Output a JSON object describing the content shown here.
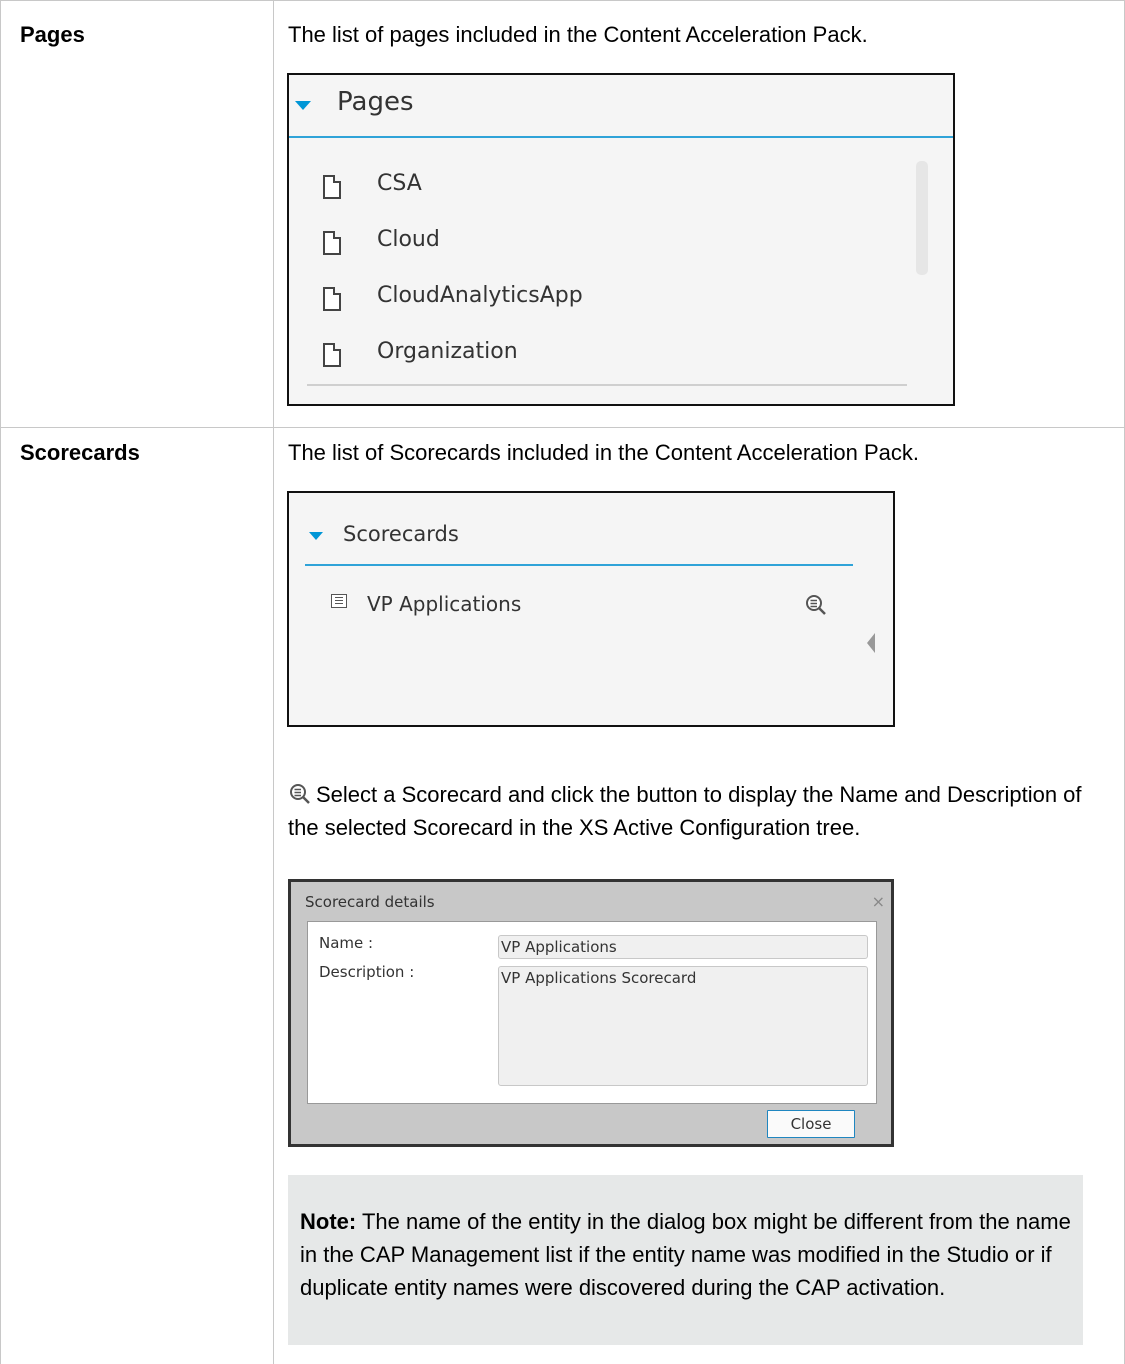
{
  "rows": [
    {
      "label": "Pages",
      "description": "The list of pages included in the Content Acceleration Pack.",
      "panel": {
        "title": "Pages",
        "items": [
          "CSA",
          "Cloud",
          "CloudAnalyticsApp",
          "Organization"
        ]
      }
    },
    {
      "label": "Scorecards",
      "description": "The list of Scorecards included in the Content Acceleration Pack.",
      "panel": {
        "title": "Scorecards",
        "items": [
          "VP Applications"
        ]
      },
      "details_text": "Select a Scorecard and click the button to display the Name and Description of the selected Scorecard in the XS Active Configuration tree.",
      "dialog": {
        "title": "Scorecard details",
        "name_label": "Name :",
        "name_value": "VP Applications",
        "description_label": "Description :",
        "description_value": "VP Applications Scorecard",
        "close_label": "Close",
        "close_x": "×"
      },
      "note": {
        "label": "Note:",
        "text": "The name of the entity in the dialog box might be different from the name in the CAP Management list if the entity name was modified in the Studio or if duplicate entity names were discovered during the CAP activation."
      }
    }
  ],
  "colors": {
    "accent": "#0096d6",
    "border": "#c8c8c8",
    "note_bg": "#e6e8e8"
  },
  "icons": [
    "caret-down-icon",
    "page-icon",
    "grid-list-icon",
    "magnifier-details-icon",
    "collapse-left-icon",
    "close-x-icon"
  ]
}
